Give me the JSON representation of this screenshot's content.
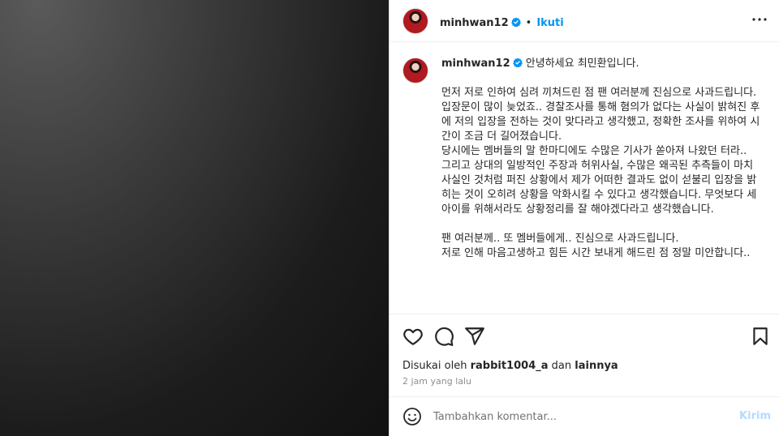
{
  "post": {
    "username": "minhwan12",
    "separator": "•",
    "follow_label": "Ikuti",
    "caption_first_line": "안녕하세요 최민환입니다.",
    "caption_body": "\n먼저 저로 인하여 심려 끼쳐드린 점 팬 여러분께 진심으로 사과드립니다.\n입장문이 많이 늦었죠.. 경찰조사를 통해 혐의가 없다는 사실이 밝혀진 후에 저의 입장을 전하는 것이 맞다라고 생각했고, 정확한 조사를 위하여 시간이 조금 더 길어졌습니다.\n당시에는 멤버들의 말 한마디에도 수많은 기사가 쏟아져 나왔던 터라..\n그리고 상대의 일방적인 주장과 허위사실, 수많은 왜곡된 추측들이 마치 사실인 것처럼 퍼진 상황에서 제가 어떠한 결과도 없이 섣불리 입장을 밝히는 것이 오히려 상황을 악화시킬 수 있다고 생각했습니다. 무엇보다 세 아이를 위해서라도 상황정리를 잘 해야겠다라고 생각했습니다.\n\n팬 여러분께.. 또 멤버들에게.. 진심으로 사과드립니다.\n저로 인해 마음고생하고 힘든 시간 보내게 해드린 점 정말 미안합니다..",
    "likes_prefix": "Disukai oleh",
    "likes_user": "rabbit1004_a",
    "likes_and": "dan",
    "likes_others": "lainnya",
    "timestamp": "2 jam yang lalu"
  },
  "comment": {
    "placeholder": "Tambahkan komentar...",
    "post_label": "Kirim"
  },
  "icons": {
    "verified": "verified-badge-icon",
    "more": "more-horizontal-icon",
    "like": "heart-icon",
    "comment": "comment-bubble-icon",
    "share": "paper-plane-icon",
    "save": "bookmark-icon",
    "emoji": "smiley-icon"
  },
  "colors": {
    "accent": "#0095f6",
    "verified": "#0095f6",
    "post_disabled": "#b3dbff"
  }
}
